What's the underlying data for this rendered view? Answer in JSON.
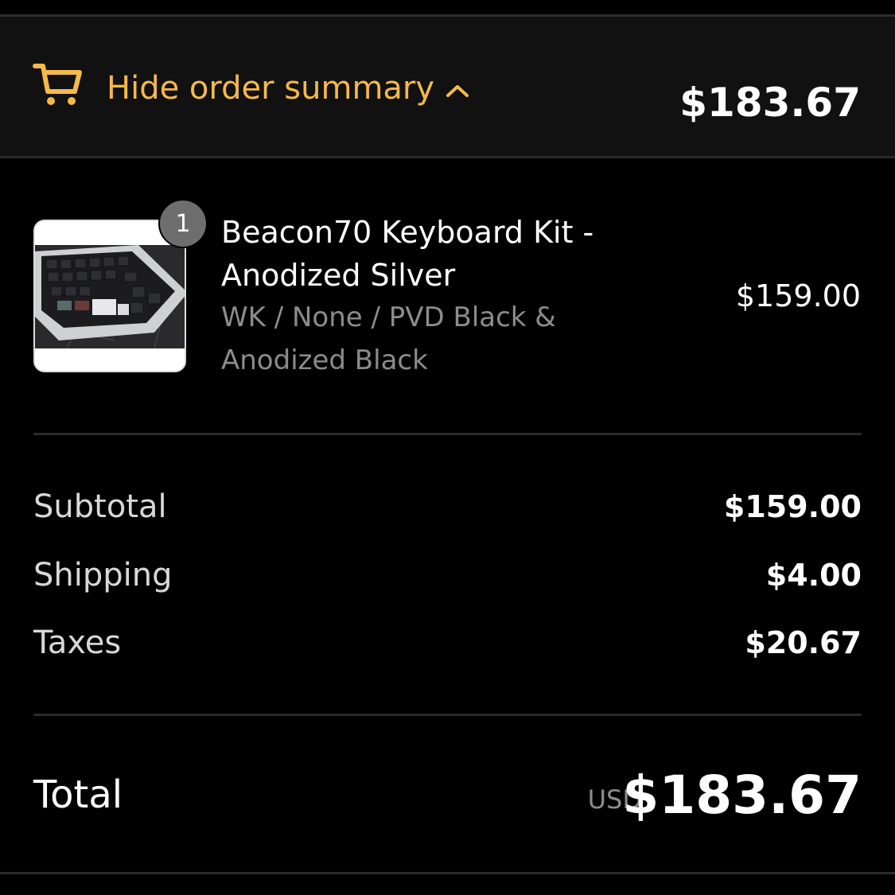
{
  "header": {
    "toggle_label": "Hide order summary",
    "total": "$183.67"
  },
  "product": {
    "quantity": "1",
    "name": "Beacon70 Keyboard Kit - Anodized Silver",
    "variant": "WK / None / PVD Black & Anodized Black",
    "price": "$159.00"
  },
  "costs": {
    "subtotal_label": "Subtotal",
    "subtotal_value": "$159.00",
    "shipping_label": "Shipping",
    "shipping_value": "$4.00",
    "taxes_label": "Taxes",
    "taxes_value": "$20.67"
  },
  "total": {
    "label": "Total",
    "currency": "USD",
    "value": "$183.67"
  },
  "icons": {
    "cart": "cart-icon",
    "toggle": "chevron-up-icon"
  },
  "colors": {
    "accent": "#f5b94a",
    "background": "#000000",
    "header_background": "#111111",
    "muted_text": "#8c8c8c",
    "badge": "#6e6e6e"
  }
}
